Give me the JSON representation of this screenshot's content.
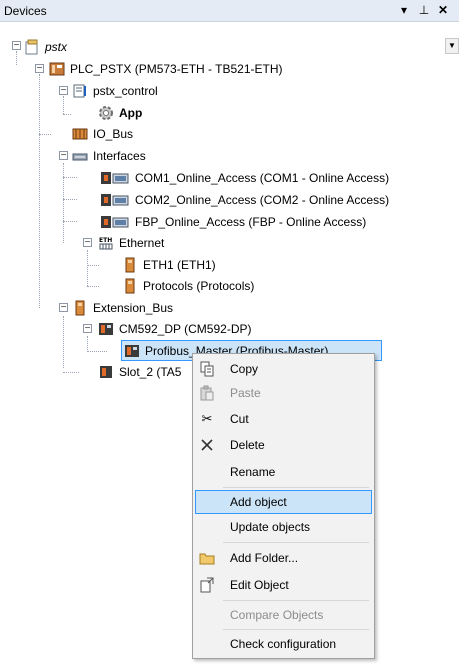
{
  "panel": {
    "title": "Devices",
    "dropdown_glyph": "▾",
    "pin_glyph": "⊥",
    "close_glyph": "✕"
  },
  "tree": {
    "root": "pstx",
    "plc": "PLC_PSTX (PM573-ETH - TB521-ETH)",
    "control": "pstx_control",
    "app": "App",
    "io_bus": "IO_Bus",
    "interfaces": "Interfaces",
    "com1": "COM1_Online_Access (COM1 - Online Access)",
    "com2": "COM2_Online_Access (COM2 - Online Access)",
    "fbp": "FBP_Online_Access (FBP - Online Access)",
    "ethernet": "Ethernet",
    "eth1": "ETH1 (ETH1)",
    "protocols": "Protocols (Protocols)",
    "ext_bus": "Extension_Bus",
    "cm592": "CM592_DP (CM592-DP)",
    "profibus": "Profibus_Master (Profibus-Master)",
    "slot2": "Slot_2 (TA5"
  },
  "context_menu": {
    "copy": "Copy",
    "paste": "Paste",
    "cut": "Cut",
    "delete": "Delete",
    "rename": "Rename",
    "add_object": "Add object",
    "update_objects": "Update objects",
    "add_folder": "Add Folder...",
    "edit_object": "Edit Object",
    "compare_objects": "Compare Objects",
    "check_configuration": "Check configuration"
  },
  "colors": {
    "selection_bg": "#cce4f7",
    "selection_border": "#3399ff",
    "titlebar_bg": "#e4ebf5"
  }
}
